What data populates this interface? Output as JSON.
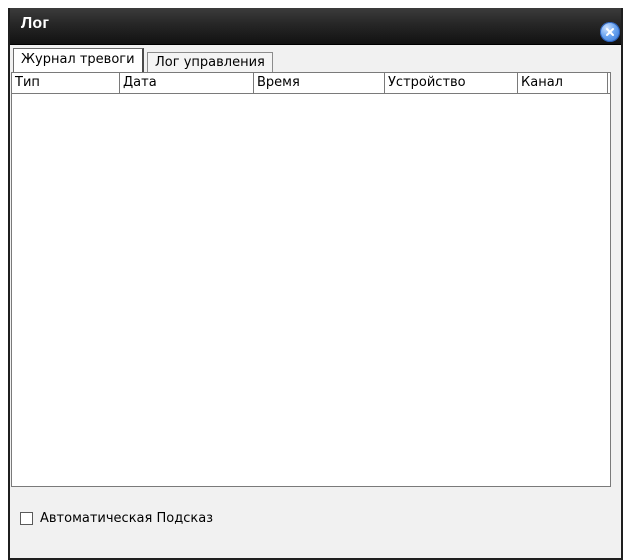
{
  "window": {
    "title": "Лог"
  },
  "tabs": [
    {
      "label": "Журнал тревоги",
      "active": true
    },
    {
      "label": "Лог управления",
      "active": false
    }
  ],
  "table": {
    "columns": [
      "Тип",
      "Дата",
      "Время",
      "Устройство",
      "Канал"
    ],
    "rows": []
  },
  "footer": {
    "auto_hint_label": "Автоматическая Подсказ",
    "auto_hint_checked": false
  },
  "icons": {
    "close": "close-icon"
  },
  "colors": {
    "titlebar": "#262626",
    "close_button": "#4f8fe6",
    "panel_bg": "#f1f1f1",
    "list_bg": "#ffffff"
  }
}
